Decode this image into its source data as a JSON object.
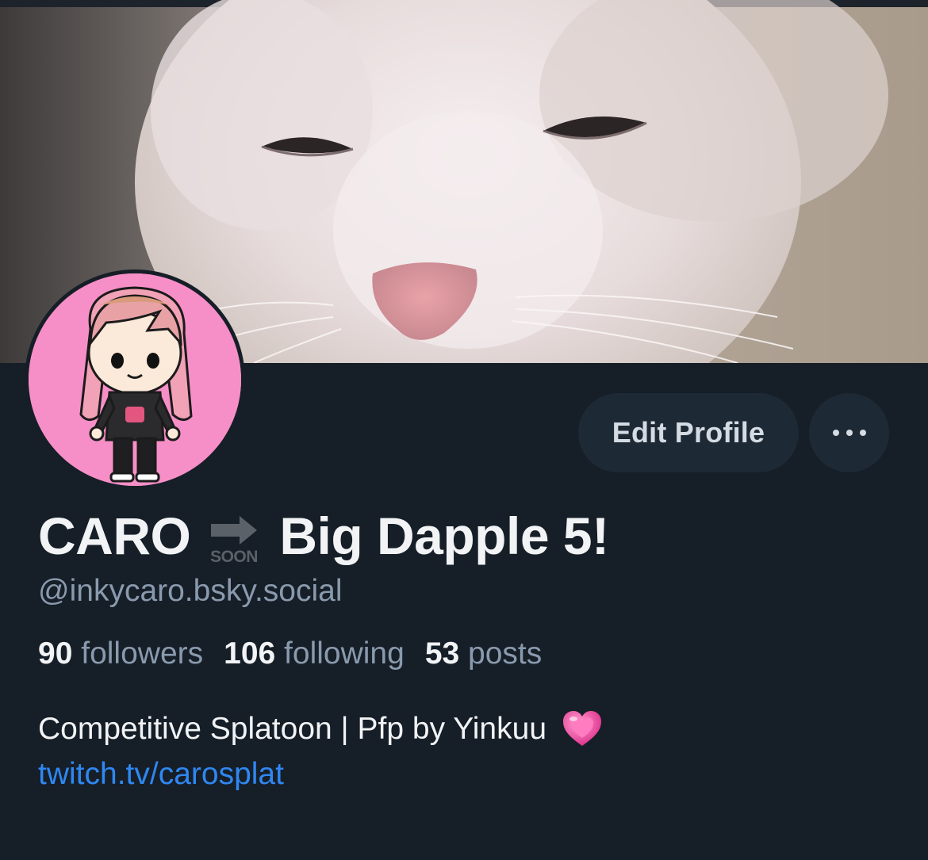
{
  "profile": {
    "name": "CARO",
    "soon_label": "SOON",
    "event_name": "Big Dapple 5!",
    "handle": "@inkycaro.bsky.social",
    "bio_text": "Competitive Splatoon | Pfp by Yinkuu",
    "bio_emoji": "heart-icon",
    "link_text": "twitch.tv/carosplat"
  },
  "stats": {
    "followers_count": "90",
    "followers_label": "followers",
    "following_count": "106",
    "following_label": "following",
    "posts_count": "53",
    "posts_label": "posts"
  },
  "actions": {
    "edit_profile_label": "Edit Profile",
    "more_icon": "ellipsis-icon"
  },
  "colors": {
    "background": "#161e27",
    "button_bg": "#1e2936",
    "primary_text": "#f1f3f5",
    "secondary_text": "#8a9aae",
    "link": "#2f87f2",
    "avatar_bg": "#f68fc7"
  }
}
